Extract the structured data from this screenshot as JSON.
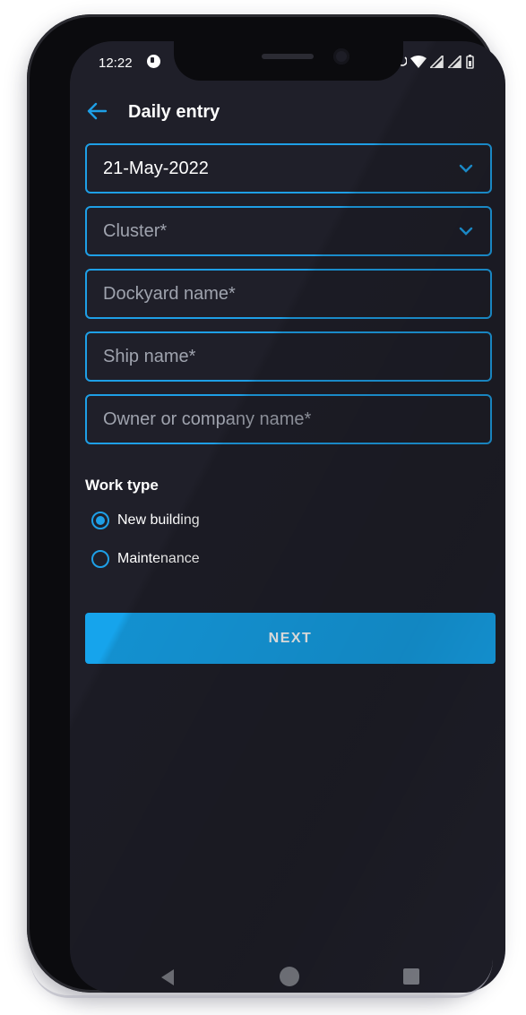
{
  "status_bar": {
    "time": "12:22"
  },
  "app_bar": {
    "title": "Daily entry",
    "back_icon": "arrow-left-icon"
  },
  "form": {
    "date_value": "21-May-2022",
    "cluster_placeholder": "Cluster*",
    "dockyard_placeholder": "Dockyard name*",
    "ship_placeholder": "Ship name*",
    "owner_placeholder": "Owner or company name*"
  },
  "work_type": {
    "label": "Work type",
    "options": [
      {
        "label": "New building",
        "selected": true
      },
      {
        "label": "Maintenance",
        "selected": false
      }
    ]
  },
  "next_label": "NEXT",
  "colors": {
    "accent": "#1e9fe6",
    "button": "#16a4ec",
    "background": "#1f1f29"
  }
}
